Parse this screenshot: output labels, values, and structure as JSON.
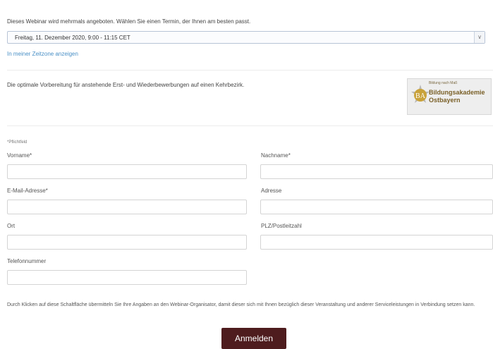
{
  "session": {
    "intro": "Dieses Webinar wird mehrmals angeboten. Wählen Sie einen Termin, der Ihnen am besten passt.",
    "selected_date": "Freitag, 11. Dezember 2020, 9:00 - 11:15 CET",
    "timezone_link": "In meiner Zeitzone anzeigen"
  },
  "description": "Die optimale Vorbereitung für anstehende Erst- und Wiederbewerbungen auf einen Kehrbezirk.",
  "logo": {
    "tagline": "Bildung nach Maß",
    "name_line1": "Bildungsakademie",
    "name_line2": "Ostbayern",
    "initials": "BA"
  },
  "form": {
    "required_note": "*Pflichtfeld",
    "firstname_label": "Vorname*",
    "lastname_label": "Nachname*",
    "email_label": "E-Mail-Adresse*",
    "address_label": "Adresse",
    "city_label": "Ort",
    "zip_label": "PLZ/Postleitzahl",
    "phone_label": "Telefonnummer"
  },
  "consent_text": "Durch Klicken auf diese Schaltfläche übermitteln Sie Ihre Angaben an den Webinar-Organisator, damit dieser sich mit Ihnen bezüglich dieser Veranstaltung und anderer Serviceleistungen in Verbindung setzen kann.",
  "submit_label": "Anmelden"
}
